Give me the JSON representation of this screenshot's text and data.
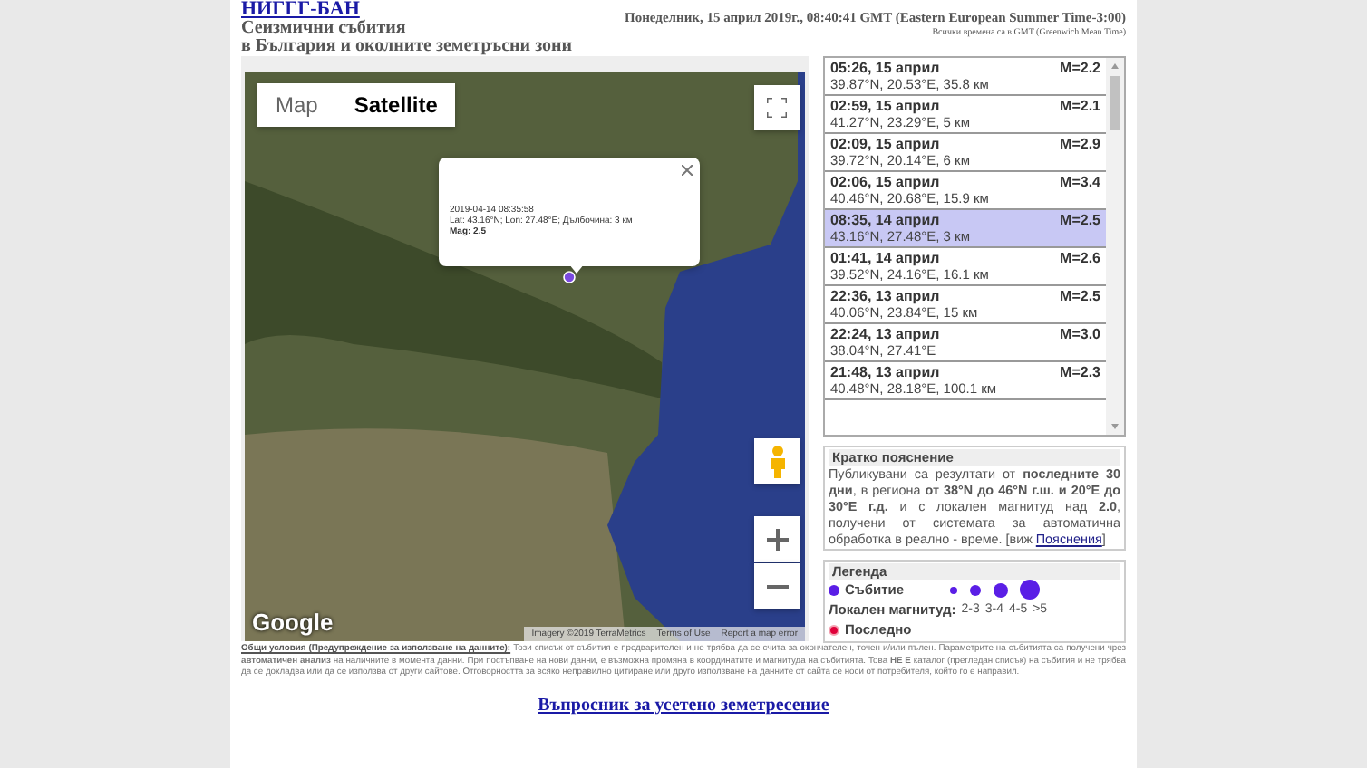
{
  "header": {
    "title": "НИГГГ-БАН",
    "subtitle": [
      "Сеизмични събития",
      "в България и околните земетръсни зони"
    ],
    "datetime": "Понеделник, 15 април 2019г., 08:40:41 GMT (Eastern European Summer Time-3:00)",
    "timezone_note": "Всички времена са в GMT (Greenwich Mean Time)"
  },
  "map": {
    "types": [
      {
        "label": "Map",
        "selected": false
      },
      {
        "label": "Satellite",
        "selected": true
      }
    ],
    "popup": {
      "datetime": "2019-04-14 08:35:58",
      "coords": "Lat: 43.16°N; Lon: 27.48°E; Дълбочина: 3 км",
      "magnitude": "Mag: 2.5"
    },
    "logo": "Google",
    "attribution": [
      "Imagery ©2019 TerraMetrics",
      "Terms of Use",
      "Report a map error"
    ]
  },
  "events": [
    {
      "time": "05:26, 15 април",
      "magnitude": "M=2.2",
      "location": "39.87°N, 20.53°E, 35.8 км",
      "selected": false
    },
    {
      "time": "02:59, 15 април",
      "magnitude": "M=2.1",
      "location": "41.27°N, 23.29°E, 5 км",
      "selected": false
    },
    {
      "time": "02:09, 15 април",
      "magnitude": "M=2.9",
      "location": "39.72°N, 20.14°E, 6 км",
      "selected": false
    },
    {
      "time": "02:06, 15 април",
      "magnitude": "M=3.4",
      "location": "40.46°N, 20.68°E, 15.9 км",
      "selected": false
    },
    {
      "time": "08:35, 14 април",
      "magnitude": "M=2.5",
      "location": "43.16°N, 27.48°E, 3 км",
      "selected": true
    },
    {
      "time": "01:41, 14 април",
      "magnitude": "M=2.6",
      "location": "39.52°N, 24.16°E, 16.1 км",
      "selected": false
    },
    {
      "time": "22:36, 13 април",
      "magnitude": "M=2.5",
      "location": "40.06°N, 23.84°E, 15 км",
      "selected": false
    },
    {
      "time": "22:24, 13 април",
      "magnitude": "M=3.0",
      "location": "38.04°N, 27.41°E",
      "selected": false
    },
    {
      "time": "21:48, 13 април",
      "magnitude": "M=2.3",
      "location": "40.48°N, 28.18°E, 100.1 км",
      "selected": false
    }
  ],
  "explanation": {
    "title": "Кратко пояснение",
    "text": "Публикувани са резултати от **последните 30 дни**, в региона **от 38°N до 46°N г.ш. и 20°E до 30°E г.д.** и с локален магнитуд над **2.0**, получени от системата за автоматична обработка в реално - време. [виж ",
    "link": "Пояснения",
    "text_end": "]"
  },
  "legend": {
    "title": "Легенда",
    "event_label": "Събитие",
    "magnitude_label": "Локален магнитуд:",
    "sizes": [
      "2-3",
      "3-4",
      "4-5",
      ">5"
    ],
    "latest_label": "Последно"
  },
  "disclaimer": {
    "link": "Общи условия (Предупреждение за използване на данните):",
    "text": "Този списък от събития е предварителен и не трябва да се счита за окончателен, точен и/или пълен. Параметрите на събитията са получени чрез **автоматичен анализ** на наличните в момента данни. При постъпване на нови данни, е възможна промяна в координатите и магнитуда на събитията. Това **НЕ Е** каталог (прегледан списък) на събития и не трябва да се докладва или да се използва от други сайтове. Отговорността за всяко неправилно цитиране или друго използване на данните от сайта се носи от потребителя, който го е направил."
  },
  "footer_link": "Въпросник за усетено земетресение"
}
